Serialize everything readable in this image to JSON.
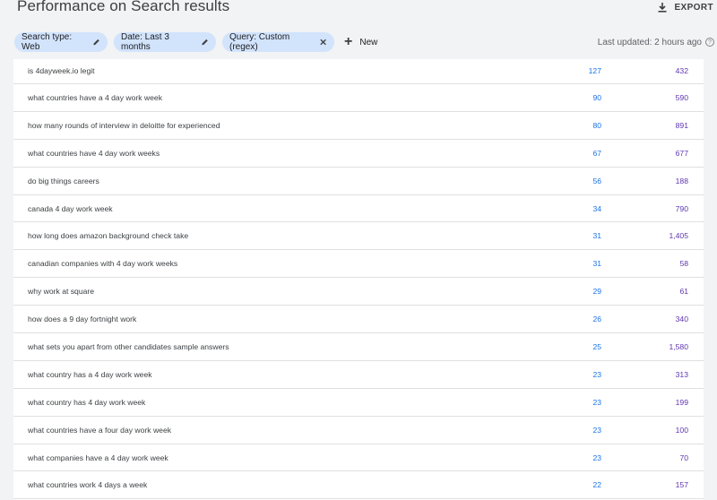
{
  "header": {
    "title": "Performance on Search results",
    "export_label": "EXPORT",
    "export_icon": "download-icon"
  },
  "filters": {
    "chips": [
      {
        "label": "Search type: Web",
        "icon": "edit-icon"
      },
      {
        "label": "Date: Last 3 months",
        "icon": "edit-icon"
      },
      {
        "label": "Query: Custom (regex)",
        "icon": "close-icon"
      }
    ],
    "new_label": "New",
    "last_updated": "Last updated: 2 hours ago"
  },
  "colors": {
    "clicks": "#1a73e8",
    "impressions": "#5e35b1",
    "chip_bg": "#d2e3fc"
  },
  "rows": [
    {
      "query": "is 4dayweek.io legit",
      "clicks": "127",
      "impressions": "432"
    },
    {
      "query": "what countries have a 4 day work week",
      "clicks": "90",
      "impressions": "590"
    },
    {
      "query": "how many rounds of interview in deloitte for experienced",
      "clicks": "80",
      "impressions": "891"
    },
    {
      "query": "what countries have 4 day work weeks",
      "clicks": "67",
      "impressions": "677"
    },
    {
      "query": "do big things careers",
      "clicks": "56",
      "impressions": "188"
    },
    {
      "query": "canada 4 day work week",
      "clicks": "34",
      "impressions": "790"
    },
    {
      "query": "how long does amazon background check take",
      "clicks": "31",
      "impressions": "1,405"
    },
    {
      "query": "canadian companies with 4 day work weeks",
      "clicks": "31",
      "impressions": "58"
    },
    {
      "query": "why work at square",
      "clicks": "29",
      "impressions": "61"
    },
    {
      "query": "how does a 9 day fortnight work",
      "clicks": "26",
      "impressions": "340"
    },
    {
      "query": "what sets you apart from other candidates sample answers",
      "clicks": "25",
      "impressions": "1,580"
    },
    {
      "query": "what country has a 4 day work week",
      "clicks": "23",
      "impressions": "313"
    },
    {
      "query": "what country has 4 day work week",
      "clicks": "23",
      "impressions": "199"
    },
    {
      "query": "what countries have a four day work week",
      "clicks": "23",
      "impressions": "100"
    },
    {
      "query": "what companies have a 4 day work week",
      "clicks": "23",
      "impressions": "70"
    },
    {
      "query": "what countries work 4 days a week",
      "clicks": "22",
      "impressions": "157"
    }
  ]
}
